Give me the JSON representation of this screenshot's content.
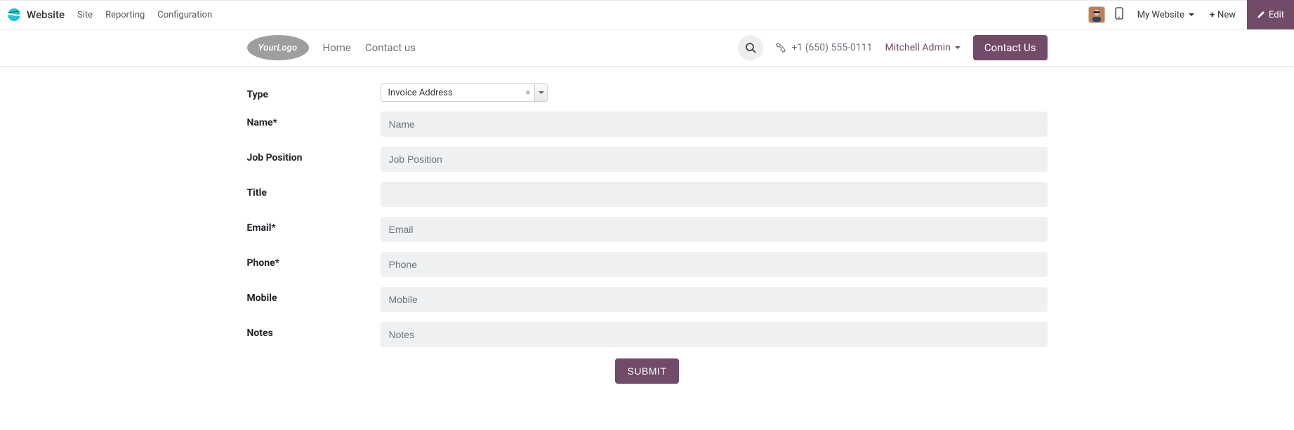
{
  "topbar": {
    "app_name": "Website",
    "menus": [
      "Site",
      "Reporting",
      "Configuration"
    ],
    "my_website_label": "My Website",
    "new_label": "New",
    "edit_label": "Edit"
  },
  "site_header": {
    "logo_text": "YourLogo",
    "nav": [
      "Home",
      "Contact us"
    ],
    "phone": "+1 (650) 555-0111",
    "user_name": "Mitchell Admin",
    "contact_btn": "Contact Us"
  },
  "form": {
    "fields": {
      "type": {
        "label": "Type",
        "value": "Invoice Address"
      },
      "name": {
        "label": "Name*",
        "placeholder": "Name"
      },
      "job_position": {
        "label": "Job Position",
        "placeholder": "Job Position"
      },
      "title": {
        "label": "Title",
        "placeholder": ""
      },
      "email": {
        "label": "Email*",
        "placeholder": "Email"
      },
      "phone": {
        "label": "Phone*",
        "placeholder": "Phone"
      },
      "mobile": {
        "label": "Mobile",
        "placeholder": "Mobile"
      },
      "notes": {
        "label": "Notes",
        "placeholder": "Notes"
      }
    },
    "submit_label": "SUBMIT"
  }
}
